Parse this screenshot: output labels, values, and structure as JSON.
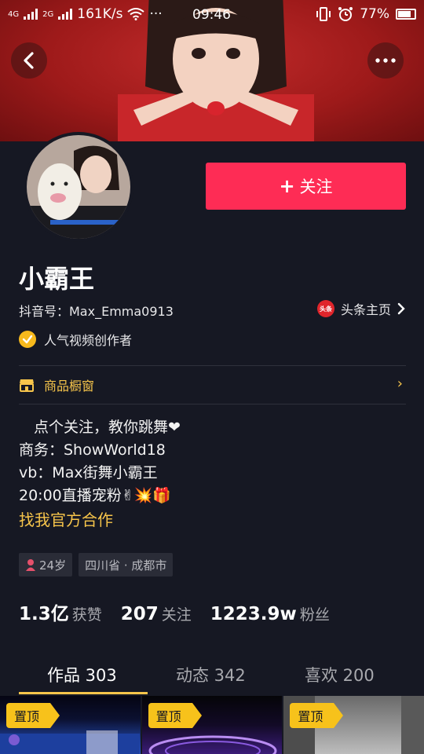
{
  "status_bar": {
    "left_net_a": "4G",
    "left_net_b": "2G",
    "speed": "161K/s",
    "dots": "···",
    "time": "09:46",
    "battery": "77%"
  },
  "nav": {
    "back_icon": "chevron-left-icon",
    "more_icon": "more-dots-icon"
  },
  "profile": {
    "follow_plus": "+",
    "follow_label": "关注",
    "name": "小霸王",
    "douyin_id": "抖音号：Max_Emma0913",
    "toutiao_badge": "头条",
    "toutiao_label": "头条主页",
    "verify_label": "人气视频创作者"
  },
  "shop": {
    "label": "商品橱窗"
  },
  "bio": {
    "line1": "　点个关注，教你跳舞❤",
    "line2": "商务：ShowWorld18",
    "line3": "vb：Max街舞小霸王",
    "line4": "20:00直播宠粉✌💥🎁",
    "cooperate": "找我官方合作"
  },
  "tags": {
    "age": "24岁",
    "location": "四川省 · 成都市"
  },
  "stats": {
    "likes_num": "1.3亿",
    "likes_label": "获赞",
    "following_num": "207",
    "following_label": "关注",
    "fans_num": "1223.9w",
    "fans_label": "粉丝"
  },
  "tabs": {
    "works": "作品 303",
    "dynamic": "动态 342",
    "likes": "喜欢 200"
  },
  "grid": {
    "pin_label": "置顶"
  },
  "colors": {
    "accent": "#fe2c55",
    "gold": "#f7c54b",
    "bg": "#161823"
  }
}
